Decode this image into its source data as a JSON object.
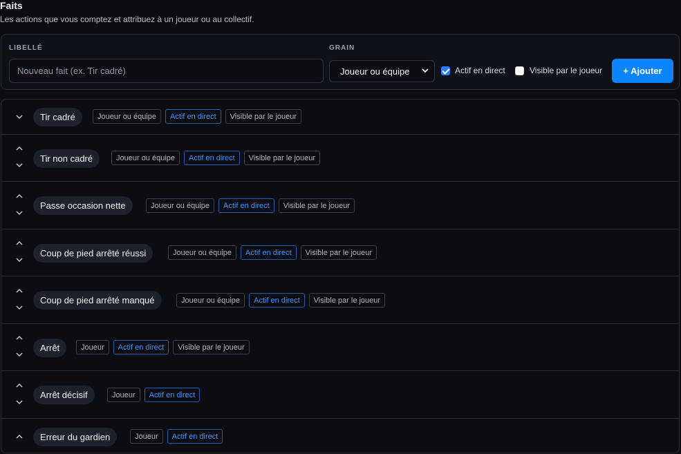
{
  "header": {
    "title": "Faits",
    "subtitle": "Les actions que vous comptez et attribuez à un joueur ou au collectif."
  },
  "form": {
    "libelle_label": "LIBELLÉ",
    "libelle_placeholder": "Nouveau fait (ex. Tir cadré)",
    "grain_label": "GRAIN",
    "grain_value": "Joueur ou équipe",
    "actif_label": "Actif en direct",
    "actif_checked": true,
    "visible_label": "Visible par le joueur",
    "visible_checked": false,
    "add_label": "+ Ajouter"
  },
  "facts": [
    {
      "name": "Tir cadré",
      "tags": [
        "Joueur ou équipe",
        "Actif en direct",
        "Visible par le joueur"
      ],
      "up": false,
      "down": true
    },
    {
      "name": "Tir non cadré",
      "tags": [
        "Joueur ou équipe",
        "Actif en direct",
        "Visible par le joueur"
      ],
      "up": true,
      "down": true
    },
    {
      "name": "Passe occasion nette",
      "tags": [
        "Joueur ou équipe",
        "Actif en direct",
        "Visible par le joueur"
      ],
      "up": true,
      "down": true
    },
    {
      "name": "Coup de pied arrêté réussi",
      "tags": [
        "Joueur ou équipe",
        "Actif en direct",
        "Visible par le joueur"
      ],
      "up": true,
      "down": true
    },
    {
      "name": "Coup de pied arrêté manqué",
      "tags": [
        "Joueur ou équipe",
        "Actif en direct",
        "Visible par le joueur"
      ],
      "up": true,
      "down": true
    },
    {
      "name": "Arrêt",
      "tags": [
        "Joueur",
        "Actif en direct",
        "Visible par le joueur"
      ],
      "up": true,
      "down": true
    },
    {
      "name": "Arrêt décisif",
      "tags": [
        "Joueur",
        "Actif en direct"
      ],
      "up": true,
      "down": true
    },
    {
      "name": "Erreur du gardien",
      "tags": [
        "Joueur",
        "Actif en direct"
      ],
      "up": true,
      "down": false
    }
  ],
  "colors": {
    "accent": "#0a84ff",
    "live_tag": "#3d95ff",
    "background": "#0b0d12"
  }
}
